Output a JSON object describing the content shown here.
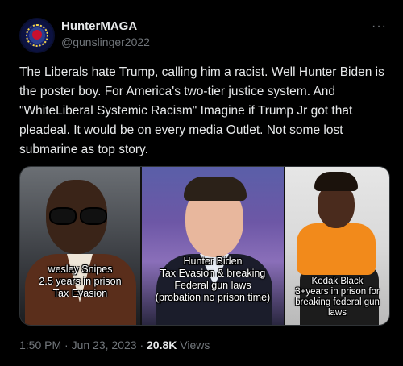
{
  "author": {
    "name": "HunterMAGA",
    "handle": "@gunslinger2022"
  },
  "more_menu": "···",
  "tweet": {
    "text": "The Liberals hate Trump, calling him a racist. Well Hunter Biden is the poster boy. For America's two-tier justice system. And \"WhiteLiberal Systemic Racism\" Imagine if Trump Jr got that pleadeal. It would be on every media Outlet. Not some lost submarine as top story."
  },
  "media": {
    "panels": [
      {
        "lines": [
          "wesley Snipes",
          "2.5 years in prison",
          "Tax Evasion"
        ]
      },
      {
        "lines": [
          "Hunter Biden",
          "Tax Evasion & breaking",
          "Federal gun laws",
          "(probation no prison time)"
        ]
      },
      {
        "lines": [
          "Kodak Black",
          "3+years in prison for",
          "breaking federal gun laws"
        ]
      }
    ]
  },
  "meta": {
    "time": "1:50 PM",
    "separator": "·",
    "date": "Jun 23, 2023",
    "views_count": "20.8K",
    "views_label": "Views"
  },
  "colors": {
    "background": "#000000",
    "text_primary": "#e7e9ea",
    "text_secondary": "#71767b",
    "border": "#2f3336"
  }
}
